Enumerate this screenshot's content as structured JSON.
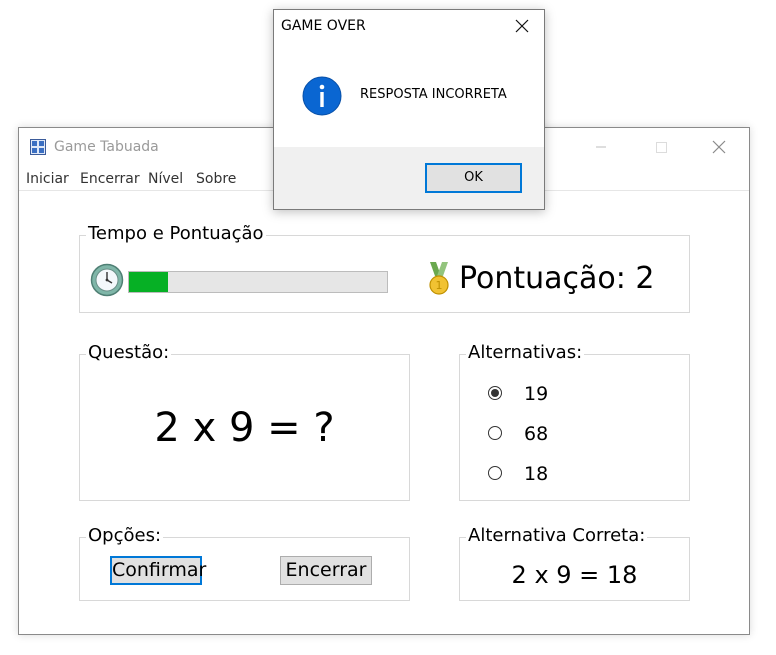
{
  "window": {
    "title": "Game Tabuada",
    "icon": "tabuada-app-icon"
  },
  "menu": [
    "Iniciar",
    "Encerrar",
    "Nível",
    "Sobre"
  ],
  "score_group": {
    "legend": "Tempo e Pontuação",
    "timer_progress_percent": 15,
    "progress_color": "#06b025",
    "score_label": "Pontuação: 2"
  },
  "question_group": {
    "legend": "Questão:",
    "question": "2 x 9 = ?"
  },
  "alternatives_group": {
    "legend": "Alternativas:",
    "options": [
      {
        "label": "19",
        "checked": true
      },
      {
        "label": "68",
        "checked": false
      },
      {
        "label": "18",
        "checked": false
      }
    ]
  },
  "options_group": {
    "legend": "Opções:",
    "confirm_label": "Confirmar",
    "end_label": "Encerrar"
  },
  "correct_group": {
    "legend": "Alternativa Correta:",
    "answer": "2 x 9 = 18"
  },
  "dialog": {
    "title": "GAME OVER",
    "message": "RESPOSTA INCORRETA",
    "ok_label": "OK",
    "icon": "info-icon",
    "accent": "#0078d7"
  }
}
